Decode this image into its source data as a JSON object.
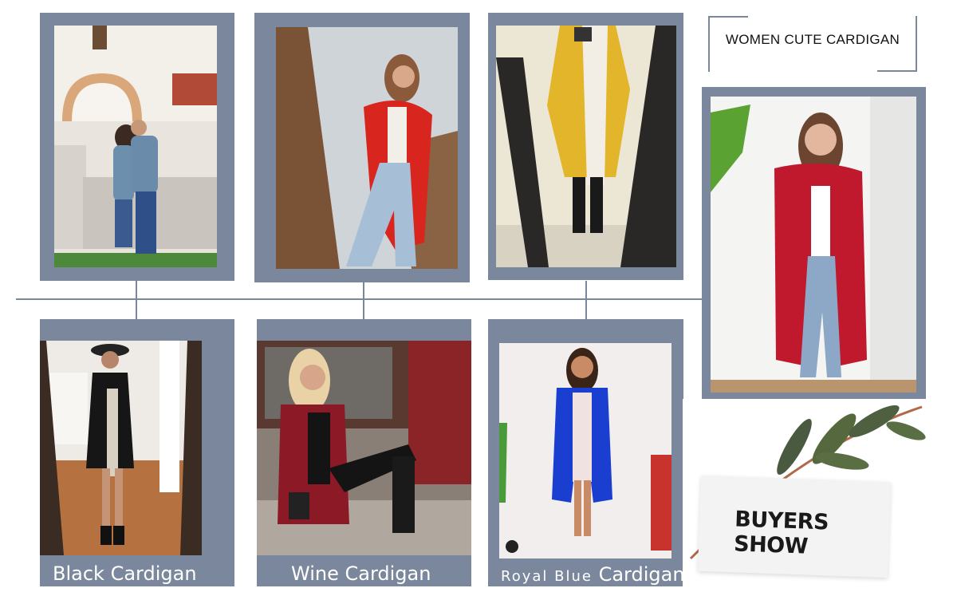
{
  "title": "WOMEN CUTE CARDIGAN",
  "buyers_show": "BUYERS SHOW",
  "photos": [
    {
      "name": "couple-photo",
      "desc": "Couple kissing on stone steps"
    },
    {
      "name": "red-cardigan-photo",
      "desc": "Woman in red cardigan on porch"
    },
    {
      "name": "yellow-cardigan-photo",
      "desc": "Mirror selfie in yellow cardigan"
    },
    {
      "name": "model-red-cardigan-photo",
      "desc": "Model in red long cardigan"
    }
  ],
  "captions": {
    "black": "Black Cardigan",
    "wine": "Wine Cardigan",
    "royal_prefix": "Royal Blue",
    "royal_suffix": "Cardigan"
  },
  "colors": {
    "frame": "#7a879c",
    "red": "#d8261f",
    "yellow": "#e2b52a",
    "wine": "#8b1a26",
    "royal_blue": "#1a3fd0",
    "model_red": "#c0182c"
  }
}
